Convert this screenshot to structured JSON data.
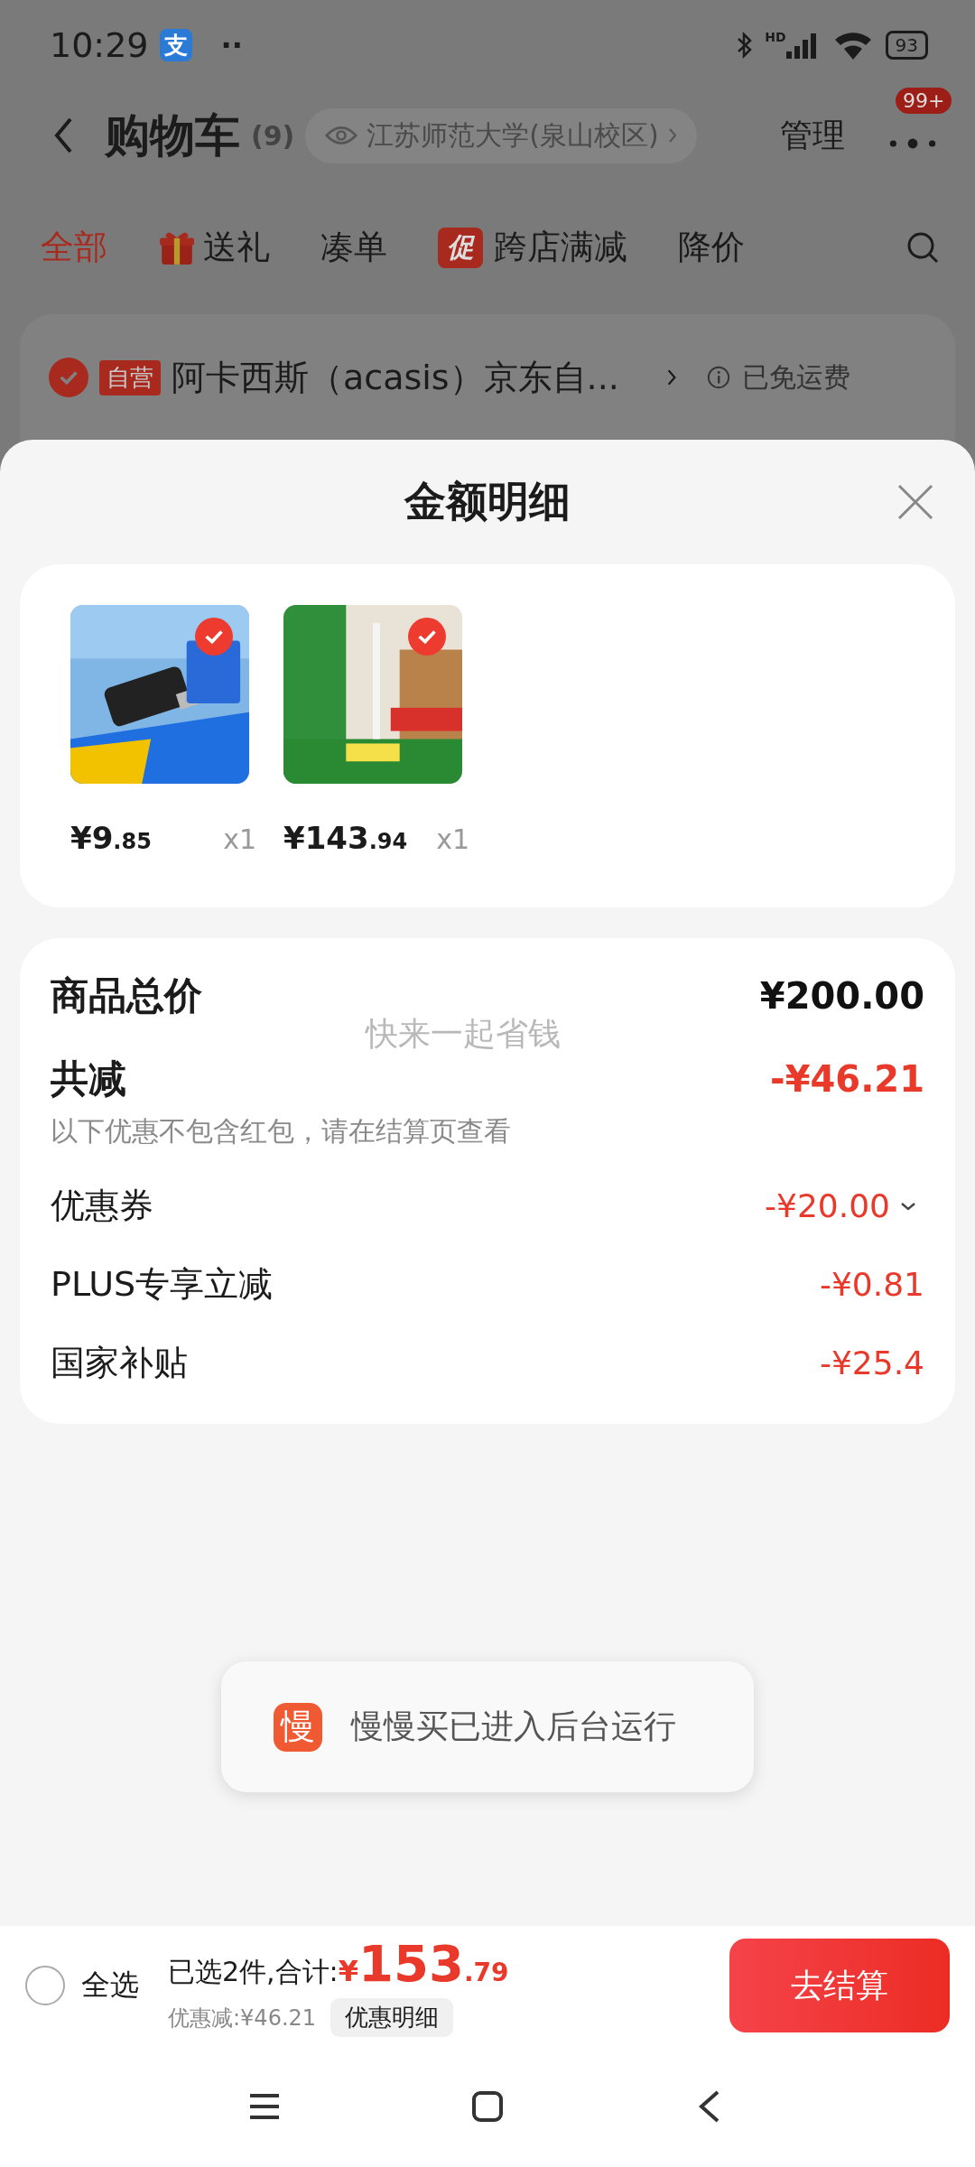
{
  "status_bar": {
    "time": "10:29",
    "app_icon_glyph": "支",
    "dots": "··",
    "network": "HD",
    "battery": "93"
  },
  "header": {
    "title": "购物车",
    "count": "(9)",
    "location": "江苏师范大学(泉山校区)",
    "manage": "管理",
    "more_badge": "99+"
  },
  "tabs": [
    {
      "label": "全部",
      "selected": true,
      "kind": "text"
    },
    {
      "label": "送礼",
      "selected": false,
      "kind": "gift"
    },
    {
      "label": "凑单",
      "selected": false,
      "kind": "text"
    },
    {
      "label": "跨店满减",
      "selected": false,
      "badge": "促",
      "kind": "badge"
    },
    {
      "label": "降价",
      "selected": false,
      "kind": "text"
    }
  ],
  "shop": {
    "checked": true,
    "tag": "自营",
    "name": "阿卡西斯（acasis）京东自...",
    "shipping": "已免运费"
  },
  "sheet": {
    "title": "金额明细",
    "products": [
      {
        "kind": "picture",
        "checked": true,
        "price_main": "¥9",
        "price_decimal": ".85",
        "quantity": "x1"
      },
      {
        "kind": "picture",
        "checked": true,
        "price_main": "¥143",
        "price_decimal": ".94",
        "quantity": "x1"
      }
    ],
    "summary": [
      {
        "kind": "total",
        "label": "商品总价",
        "value": "¥200.00",
        "dropdown": false
      },
      {
        "kind": "discount_total",
        "label": "共减",
        "value": "-¥46.21",
        "note": "以下优惠不包含红包，请在结算页查看",
        "dropdown": false
      },
      {
        "kind": "item",
        "label": "优惠券",
        "value": "-¥20.00",
        "dropdown": true
      },
      {
        "kind": "item",
        "label": "PLUS专享立减",
        "value": "-¥0.81",
        "dropdown": false
      },
      {
        "kind": "item",
        "label": "国家补贴",
        "value": "-¥25.4",
        "dropdown": false
      }
    ],
    "overlay_text": "快来一起省钱"
  },
  "toast": {
    "icon_glyph": "慢",
    "text": "慢慢买已进入后台运行"
  },
  "bottom_bar": {
    "select_all": {
      "label": "全选",
      "checked": false
    },
    "selected_text": "已选2件,合计:",
    "currency": "¥",
    "total_main": "153",
    "total_decimal": ".79",
    "discount": "优惠减:¥46.21",
    "details_button": "优惠明细",
    "checkout": "去结算"
  }
}
